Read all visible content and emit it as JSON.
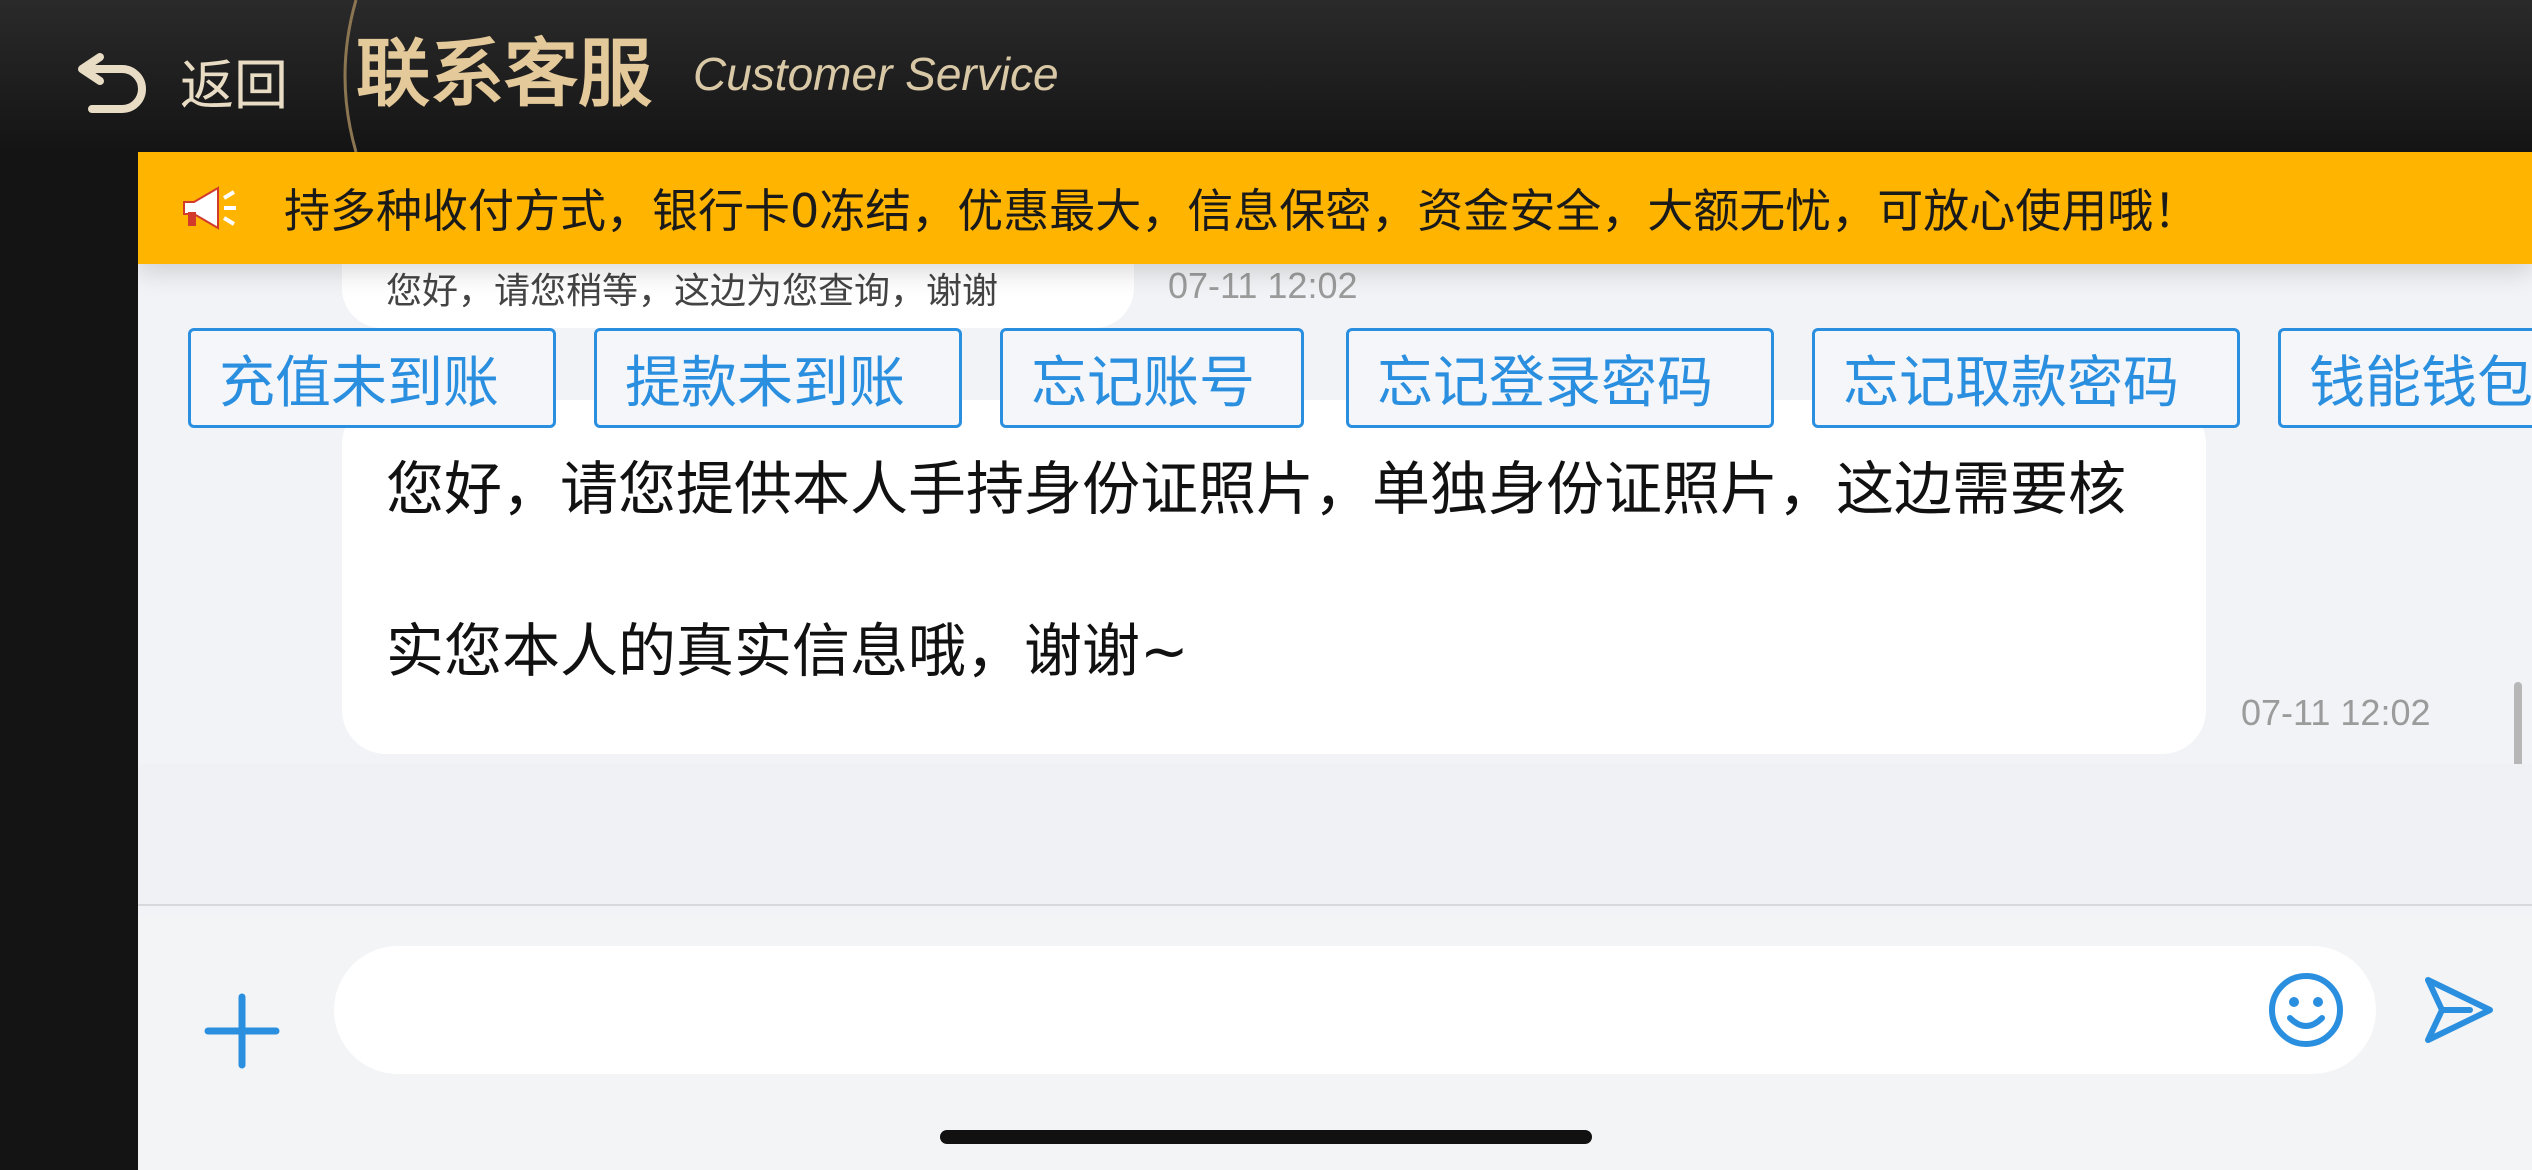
{
  "header": {
    "back_label": "返回",
    "title_cn": "联系客服",
    "title_en": "Customer Service"
  },
  "notice": {
    "icon": "megaphone-icon",
    "text": "持多种收付方式，银行卡0冻结，优惠最大，信息保密，资金安全，大额无忧，可放心使用哦！"
  },
  "messages": [
    {
      "text": "您好，请您稍等，这边为您查询，谢谢",
      "time": "07-11 12:02"
    },
    {
      "text": "您好，请您提供本人手持身份证照片，单独身份证照片，这边需要核实您本人的真实信息哦，谢谢~",
      "time": "07-11 12:02"
    }
  ],
  "quick_replies": [
    "充值未到账",
    "提款未到账",
    "忘记账号",
    "忘记登录密码",
    "忘记取款密码",
    "钱能钱包"
  ],
  "input": {
    "value": "",
    "placeholder": ""
  },
  "icons": {
    "back": "back-arrow-icon",
    "add": "plus-icon",
    "emoji": "emoji-icon",
    "send": "send-icon"
  },
  "colors": {
    "accent": "#2b8fe0",
    "notice_bg": "#ffb400",
    "header_title": "#e4c99a"
  }
}
